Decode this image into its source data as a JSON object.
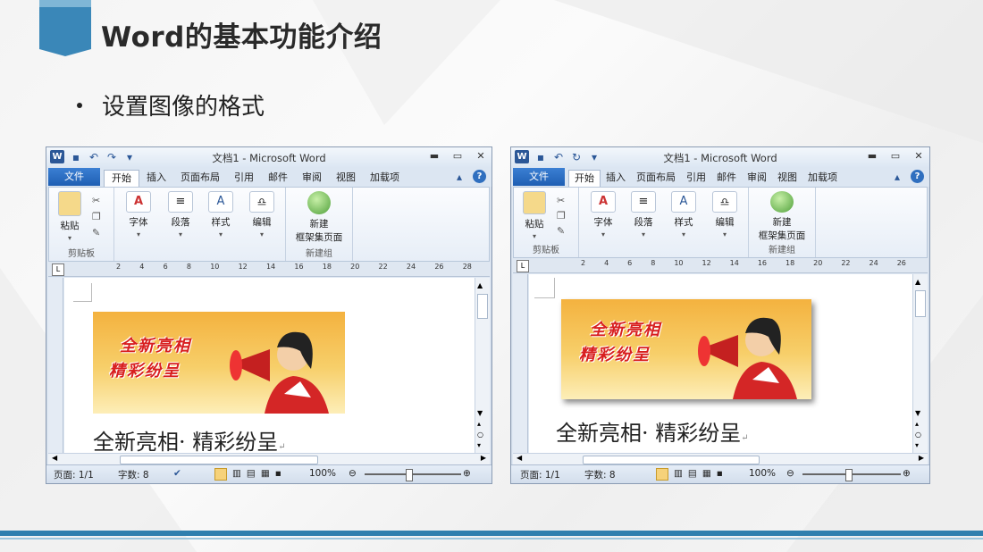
{
  "slide": {
    "title": "Word的基本功能介绍",
    "bullet": "设置图像的格式"
  },
  "windows": [
    {
      "title": "文档1 - Microsoft Word",
      "file_tab": "文件",
      "tabs": [
        "开始",
        "插入",
        "页面布局",
        "引用",
        "邮件",
        "审阅",
        "视图",
        "加载项"
      ],
      "groups": {
        "clipboard": {
          "paste": "粘贴",
          "label": "剪贴板"
        },
        "font": "字体",
        "paragraph": "段落",
        "styles": "样式",
        "editing": "编辑",
        "newgroup": {
          "btn_line1": "新建",
          "btn_line2": "框架集页面",
          "label": "新建组"
        }
      },
      "ruler": [
        "2",
        "4",
        "6",
        "8",
        "10",
        "12",
        "14",
        "16",
        "18",
        "20",
        "22",
        "24",
        "26",
        "28"
      ],
      "image": {
        "line1": "全新亮相",
        "line2": "精彩纷呈"
      },
      "doc_text": "全新亮相· 精彩纷呈",
      "status": {
        "page": "页面: 1/1",
        "words": "字数: 8",
        "zoom": "100%"
      }
    },
    {
      "title": "文档1 - Microsoft Word",
      "file_tab": "文件",
      "tabs": [
        "开始",
        "插入",
        "页面布局",
        "引用",
        "邮件",
        "审阅",
        "视图",
        "加载项"
      ],
      "groups": {
        "clipboard": {
          "paste": "粘贴",
          "label": "剪贴板"
        },
        "font": "字体",
        "paragraph": "段落",
        "styles": "样式",
        "editing": "编辑",
        "newgroup": {
          "btn_line1": "新建",
          "btn_line2": "框架集页面",
          "label": "新建组"
        }
      },
      "ruler": [
        "2",
        "4",
        "6",
        "8",
        "10",
        "12",
        "14",
        "16",
        "18",
        "20",
        "22",
        "24",
        "26"
      ],
      "image": {
        "line1": "全新亮相",
        "line2": "精彩纷呈"
      },
      "doc_text": "全新亮相· 精彩纷呈",
      "status": {
        "page": "页面: 1/1",
        "words": "字数: 8",
        "zoom": "100%"
      }
    }
  ]
}
